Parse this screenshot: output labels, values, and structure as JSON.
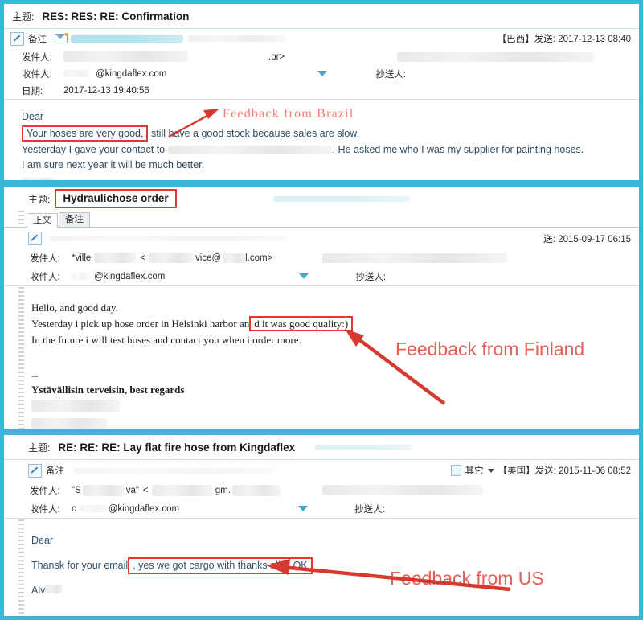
{
  "theme": {
    "frame_color": "#3ab6d9",
    "annotation_color": "#e06058",
    "highlight_box_color": "#e8372c",
    "body_text_color": "#2e4a62"
  },
  "panels": [
    {
      "id": "brazil",
      "subject_label": "主题:",
      "subject_text": "RES: RES: RE: Confirmation",
      "toolbar": {
        "note_label": "备注",
        "pencil_icon": "pencil-icon",
        "envelope_icon": "envelope-icon"
      },
      "sent_info": "【巴西】发送: 2017-12-13 08:40",
      "meta": [
        {
          "label": "发件人:",
          "value": ".br>"
        },
        {
          "label": "收件人:",
          "value": "@kingdaflex.com"
        },
        {
          "label": "日期:",
          "value": "2017-12-13 19:40:56"
        }
      ],
      "cc_label": "抄送人:",
      "caret_icon": "chevron-down-icon",
      "body": [
        {
          "text": "Dear",
          "highlight": false
        },
        {
          "text": "Your hoses are very good,",
          "highlight": true,
          "suffix": " still have a good stock because sales are slow."
        },
        {
          "text": "Yesterday I gave your contact to",
          "highlight": false,
          "suffix": ". He asked me who I was my supplier for painting hoses."
        },
        {
          "text": "I am sure next year it will be much better.",
          "highlight": false
        }
      ],
      "annotation": "Feedback from Brazil"
    },
    {
      "id": "finland",
      "subject_label": "主题:",
      "subject_text": "Hydraulichose order",
      "subject_boxed": true,
      "tabs": [
        {
          "label": "正文",
          "active": true
        },
        {
          "label": "备注",
          "active": false
        }
      ],
      "toolbar": {
        "pencil_icon": "pencil-icon"
      },
      "sent_info": "送: 2015-09-17 06:15",
      "meta": [
        {
          "label": "发件人:",
          "value": "*ville",
          "value2": "vice@",
          "value3": "l.com>"
        },
        {
          "label": "收件人:",
          "value": "@kingdaflex.com"
        }
      ],
      "cc_label": "抄送人:",
      "caret_icon": "chevron-down-icon",
      "body": [
        {
          "text": "Hello, and good day.",
          "highlight": false
        },
        {
          "text": "Yesterday i pick up hose order in Helsinki harbor an",
          "highlight": false,
          "boxed_tail": "d it was good quality:)"
        },
        {
          "text": "In the future i will test hoses and contact you when i order more.",
          "highlight": false
        }
      ],
      "signature": [
        "--",
        "Ystävällisin terveisin, best regards"
      ],
      "annotation": "Feedback from Finland"
    },
    {
      "id": "us",
      "subject_label": "主题:",
      "subject_text": "RE: RE: RE: Lay flat fire hose from Kingdaflex",
      "toolbar": {
        "note_label": "备注",
        "pencil_icon": "pencil-icon"
      },
      "category_label": "其它",
      "category_icon": "list-icon",
      "category_caret": "chevron-down-icon",
      "sent_info": "【美国】发送: 2015-11-06 08:52",
      "meta": [
        {
          "label": "发件人:",
          "value": "\"S",
          "value2": "va\"",
          "value3": "gm."
        },
        {
          "label": "收件人:",
          "value": "@kingdaflex.com"
        }
      ],
      "cc_label": "抄送人:",
      "caret_icon": "chevron-down-icon",
      "body": [
        {
          "text": "Dear",
          "highlight": false
        },
        {
          "text": "Thansk for your email",
          "highlight": false,
          "boxed_tail": ", yes we got cargo with thanks all is OK"
        },
        {
          "text": "Alv",
          "highlight": false
        }
      ],
      "annotation": "Feedback from US"
    }
  ]
}
